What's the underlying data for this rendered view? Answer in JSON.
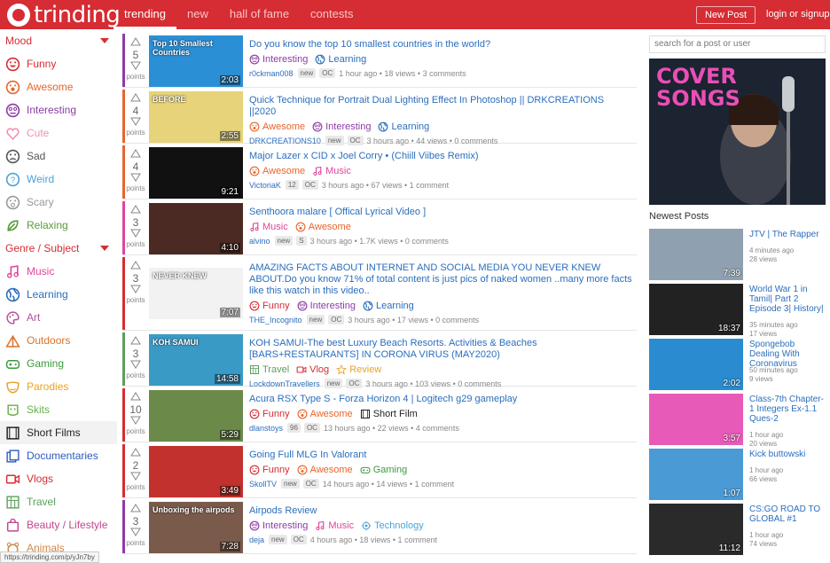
{
  "header": {
    "logo": "trinding",
    "nav": [
      "trending",
      "new",
      "hall of fame",
      "contests"
    ],
    "new_post": "New Post",
    "login": "login or signup"
  },
  "sidebar": {
    "mood_title": "Mood",
    "mood": [
      {
        "label": "Funny",
        "color": "#d62c33",
        "icon": "funny-icon"
      },
      {
        "label": "Awesome",
        "color": "#e8652b",
        "icon": "awesome-icon"
      },
      {
        "label": "Interesting",
        "color": "#8e3aa8",
        "icon": "interesting-icon"
      },
      {
        "label": "Cute",
        "color": "#f48fb1",
        "icon": "heart-icon"
      },
      {
        "label": "Sad",
        "color": "#555555",
        "icon": "sad-icon"
      },
      {
        "label": "Weird",
        "color": "#4aa3d8",
        "icon": "weird-icon"
      },
      {
        "label": "Scary",
        "color": "#999999",
        "icon": "scary-icon"
      },
      {
        "label": "Relaxing",
        "color": "#5a9b3a",
        "icon": "leaf-icon"
      }
    ],
    "genre_title": "Genre / Subject",
    "genre": [
      {
        "label": "Music",
        "color": "#e0459b",
        "icon": "music-icon"
      },
      {
        "label": "Learning",
        "color": "#2b6ebd",
        "icon": "globe-icon"
      },
      {
        "label": "Art",
        "color": "#b4529a",
        "icon": "art-icon"
      },
      {
        "label": "Outdoors",
        "color": "#d9732a",
        "icon": "tent-icon"
      },
      {
        "label": "Gaming",
        "color": "#3a9a3a",
        "icon": "gamepad-icon"
      },
      {
        "label": "Parodies",
        "color": "#e8a227",
        "icon": "mask-icon"
      },
      {
        "label": "Skits",
        "color": "#6ab04c",
        "icon": "skits-icon"
      },
      {
        "label": "Short Films",
        "color": "#222222",
        "icon": "film-icon"
      },
      {
        "label": "Documentaries",
        "color": "#2b5bbd",
        "icon": "docs-icon"
      },
      {
        "label": "Vlogs",
        "color": "#d62c33",
        "icon": "vlog-icon"
      },
      {
        "label": "Travel",
        "color": "#5aa05a",
        "icon": "map-icon"
      },
      {
        "label": "Beauty / Lifestyle",
        "color": "#c4468e",
        "icon": "bag-icon"
      },
      {
        "label": "Animals",
        "color": "#d08a4a",
        "icon": "animal-icon"
      }
    ]
  },
  "posts": [
    {
      "points": "5",
      "pts": "points",
      "title": "Do you know the top 10 smallest countries in the world?",
      "tags": [
        {
          "l": "Interesting",
          "c": "#8e3aa8"
        },
        {
          "l": "Learning",
          "c": "#2b6ebd"
        }
      ],
      "user": "r0ckman008",
      "badges": [
        "new",
        "OC"
      ],
      "meta": "1 hour ago • 18 views • 3 comments",
      "dur": "2:03",
      "bar": "#8e3aa8",
      "thumb": "#2b8fd6",
      "ttext": "Top 10 Smallest Countries"
    },
    {
      "points": "4",
      "pts": "points",
      "title": "Quick Technique for Portrait Dual Lighting Effect In Photoshop || DRKCREATIONS ||2020",
      "tags": [
        {
          "l": "Awesome",
          "c": "#e8652b"
        },
        {
          "l": "Interesting",
          "c": "#8e3aa8"
        },
        {
          "l": "Learning",
          "c": "#2b6ebd"
        }
      ],
      "user": "DRKCREATIONS10",
      "badges": [
        "new",
        "OC"
      ],
      "meta": "3 hours ago • 44 views • 0 comments",
      "dur": "2:55",
      "bar": "#e8652b",
      "thumb": "#e6d37a",
      "ttext": "BEFORE"
    },
    {
      "points": "4",
      "pts": "points",
      "title": "Major Lazer x CID x Joel Corry • (Chiill Viibes Remix)",
      "tags": [
        {
          "l": "Awesome",
          "c": "#e8652b"
        },
        {
          "l": "Music",
          "c": "#e0459b"
        }
      ],
      "user": "VictoriaK",
      "badges": [
        "12",
        "OC"
      ],
      "meta": "3 hours ago • 67 views • 1 comment",
      "dur": "9:21",
      "bar": "#e8652b",
      "thumb": "#111111",
      "ttext": ""
    },
    {
      "points": "3",
      "pts": "points",
      "title": "Senthoora malare [ Offical Lyrical Video ]",
      "tags": [
        {
          "l": "Music",
          "c": "#e0459b"
        },
        {
          "l": "Awesome",
          "c": "#e8652b"
        }
      ],
      "user": "alvino",
      "badges": [
        "new",
        "S"
      ],
      "meta": "3 hours ago • 1.7K views • 0 comments",
      "dur": "4:10",
      "bar": "#e0459b",
      "thumb": "#4a2a22",
      "ttext": ""
    },
    {
      "points": "3",
      "pts": "points",
      "title": "AMAZING FACTS ABOUT INTERNET AND SOCIAL MEDIA YOU NEVER KNEW ABOUT.Do you know 71% of total content is just pics of naked women ..many more facts like this watch in this video..",
      "tags": [
        {
          "l": "Funny",
          "c": "#d62c33"
        },
        {
          "l": "Interesting",
          "c": "#8e3aa8"
        },
        {
          "l": "Learning",
          "c": "#2b6ebd"
        }
      ],
      "user": "THE_Incognito",
      "badges": [
        "new",
        "OC"
      ],
      "meta": "3 hours ago • 17 views • 0 comments",
      "dur": "7:07",
      "bar": "#d62c33",
      "thumb": "#f2f2f2",
      "ttext": "NEVER KNEW"
    },
    {
      "points": "3",
      "pts": "points",
      "title": "KOH SAMUI-The best Luxury Beach Resorts. Activities & Beaches [BARS+RESTAURANTS] IN CORONA VIRUS (MAY2020)",
      "tags": [
        {
          "l": "Travel",
          "c": "#5aa05a"
        },
        {
          "l": "Vlog",
          "c": "#d62c33"
        },
        {
          "l": "Review",
          "c": "#e8a227"
        }
      ],
      "user": "LockdownTravellers",
      "badges": [
        "new",
        "OC"
      ],
      "meta": "3 hours ago • 103 views • 0 comments",
      "dur": "14:58",
      "bar": "#5aa05a",
      "thumb": "#3a9ac6",
      "ttext": "KOH SAMUI"
    },
    {
      "points": "10",
      "pts": "points",
      "title": "Acura RSX Type S - Forza Horizon 4 | Logitech g29 gameplay",
      "tags": [
        {
          "l": "Funny",
          "c": "#d62c33"
        },
        {
          "l": "Awesome",
          "c": "#e8652b"
        },
        {
          "l": "Short Film",
          "c": "#222222"
        }
      ],
      "user": "dlanstoys",
      "badges": [
        "96",
        "OC"
      ],
      "meta": "13 hours ago • 22 views • 4 comments",
      "dur": "5:29",
      "bar": "#d62c33",
      "thumb": "#6b8a4a",
      "ttext": ""
    },
    {
      "points": "2",
      "pts": "points",
      "title": "Going Full MLG In Valorant",
      "tags": [
        {
          "l": "Funny",
          "c": "#d62c33"
        },
        {
          "l": "Awesome",
          "c": "#e8652b"
        },
        {
          "l": "Gaming",
          "c": "#3a9a3a"
        }
      ],
      "user": "SkollTV",
      "badges": [
        "new",
        "OC"
      ],
      "meta": "14 hours ago • 14 views • 1 comment",
      "dur": "3:49",
      "bar": "#d62c33",
      "thumb": "#c2312e",
      "ttext": ""
    },
    {
      "points": "3",
      "pts": "points",
      "title": "Airpods Review",
      "tags": [
        {
          "l": "Interesting",
          "c": "#8e3aa8"
        },
        {
          "l": "Music",
          "c": "#e0459b"
        },
        {
          "l": "Technology",
          "c": "#4aa3d8"
        }
      ],
      "user": "deja",
      "badges": [
        "new",
        "OC"
      ],
      "meta": "4 hours ago • 18 views • 1 comment",
      "dur": "7:28",
      "bar": "#8e3aa8",
      "thumb": "#7a5a4a",
      "ttext": "Unboxing the airpods"
    }
  ],
  "right": {
    "search_placeholder": "search for a post or user",
    "promo_text": "COVER SONGS",
    "newest_title": "Newest Posts",
    "newest": [
      {
        "title": "JTV | The Rapper",
        "t": "4 minutes ago",
        "v": "28 views",
        "dur": "7:39",
        "c": "#8fa0b0"
      },
      {
        "title": "World War 1 in Tamil| Part 2 Episode 3| History|",
        "t": "35 minutes ago",
        "v": "17 views",
        "dur": "18:37",
        "c": "#222222"
      },
      {
        "title": "Spongebob Dealing With Coronavirus",
        "t": "50 minutes ago",
        "v": "9 views",
        "dur": "2:02",
        "c": "#2a8bd0"
      },
      {
        "title": "Class-7th Chapter-1 Integers Ex-1.1 Ques-2",
        "t": "1 hour ago",
        "v": "20 views",
        "dur": "3:57",
        "c": "#e85ab8"
      },
      {
        "title": "Kick buttowski",
        "t": "1 hour ago",
        "v": "66 views",
        "dur": "1:07",
        "c": "#4a9ad6"
      },
      {
        "title": "CS:GO ROAD TO GLOBAL #1",
        "t": "1 hour ago",
        "v": "74 views",
        "dur": "11:12",
        "c": "#2a2a2a"
      }
    ]
  },
  "status_url": "https://trinding.com/p/yJn7by"
}
